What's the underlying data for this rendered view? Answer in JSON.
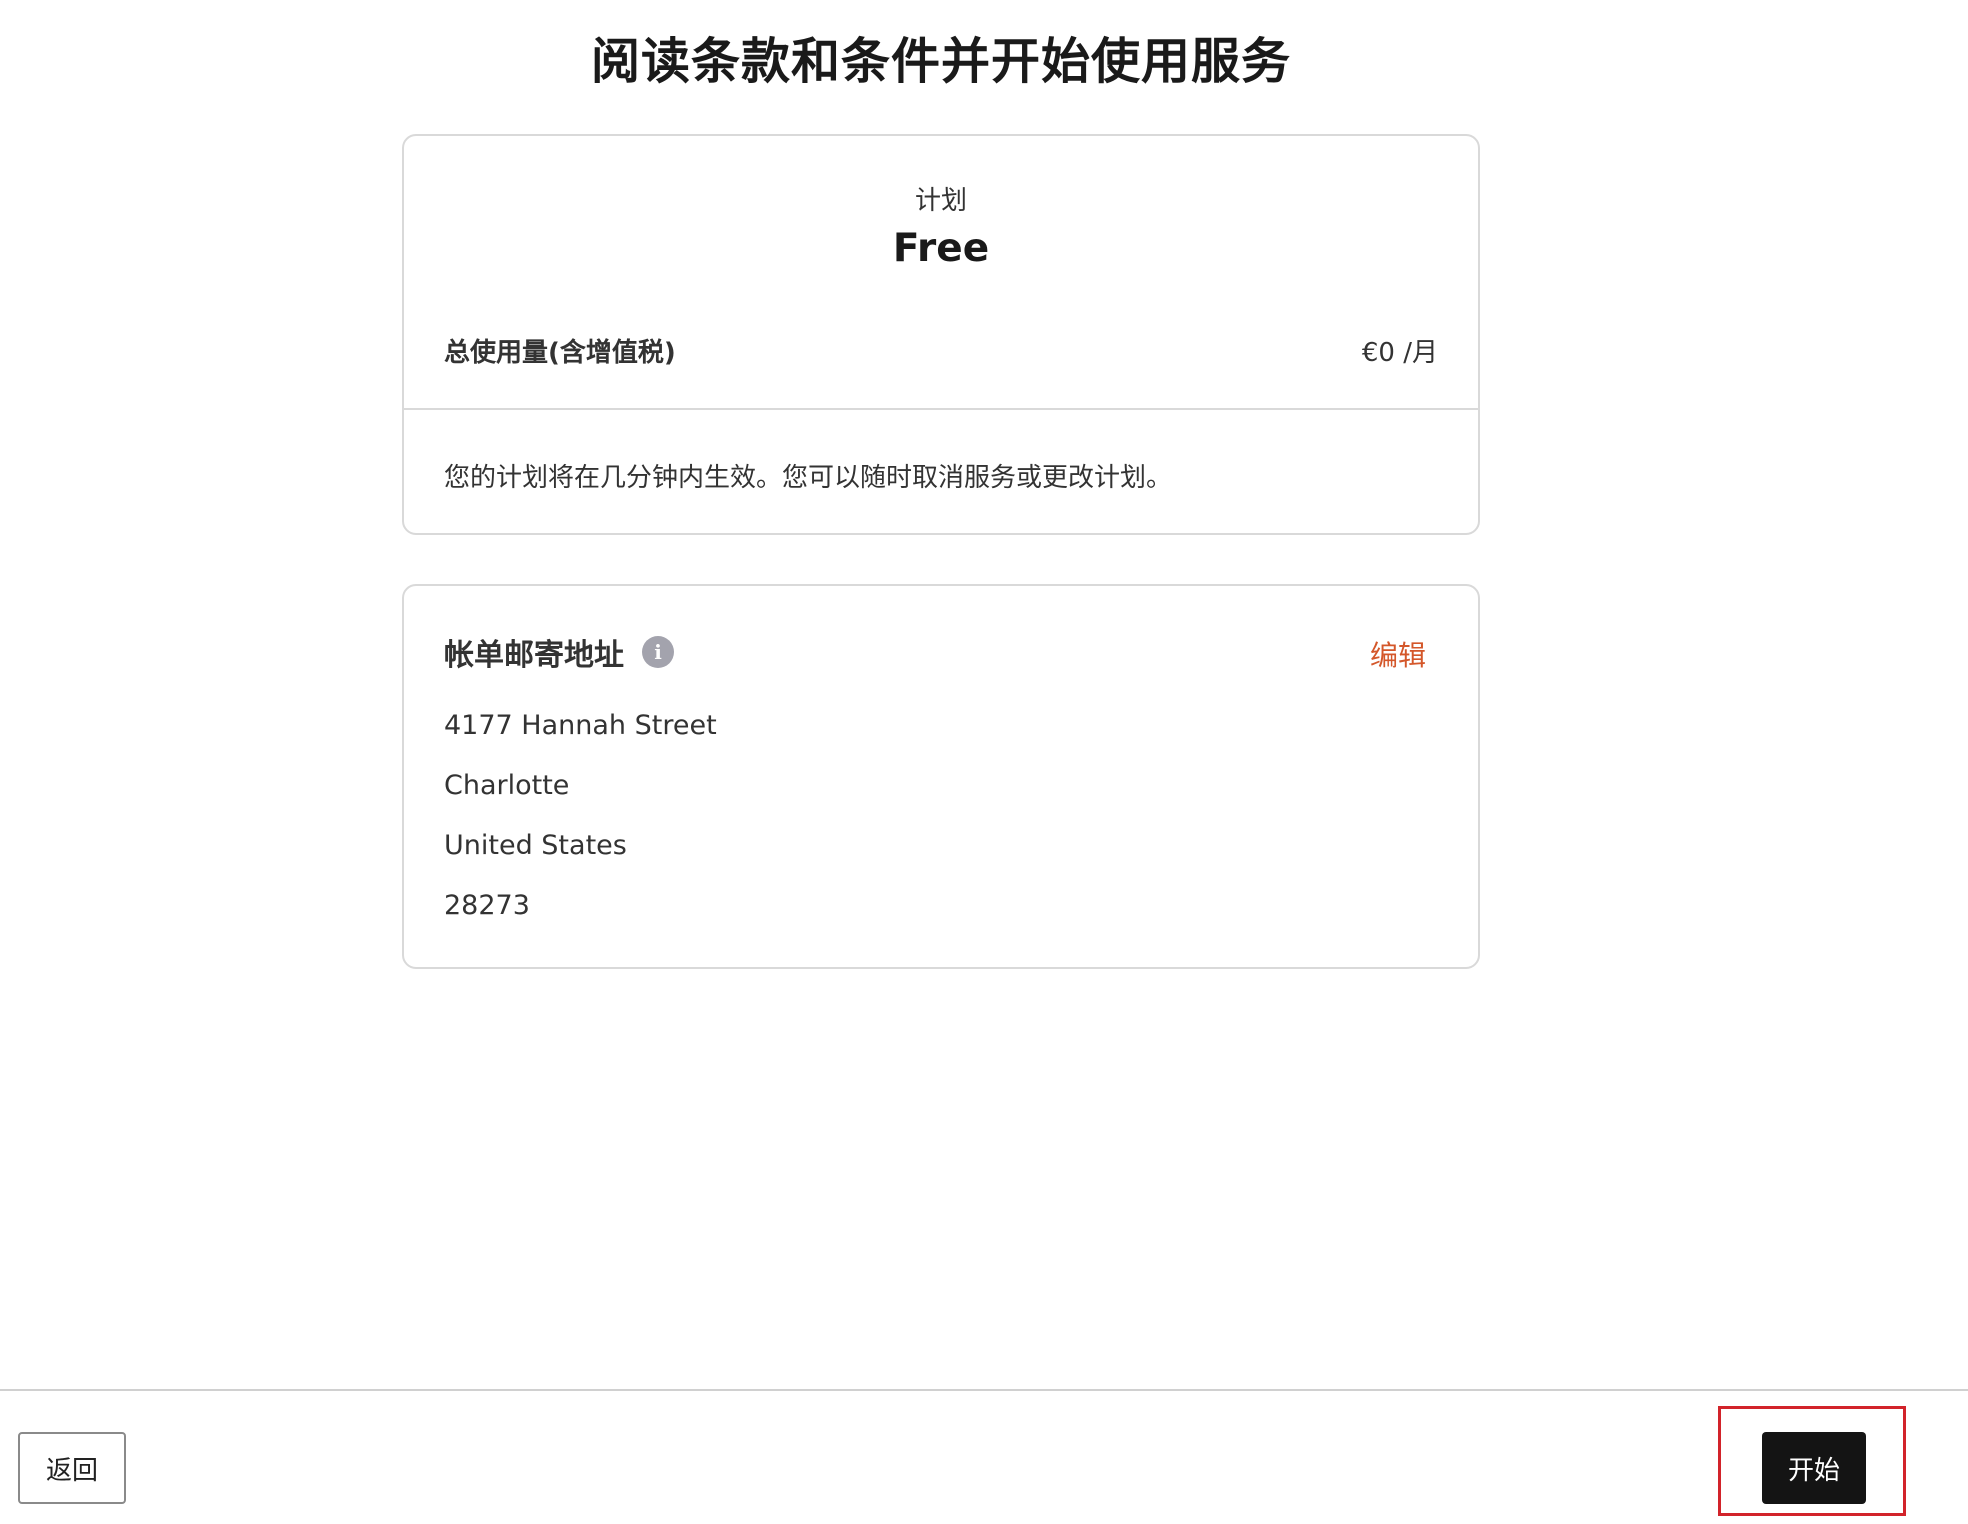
{
  "page": {
    "title": "阅读条款和条件并开始使用服务"
  },
  "plan": {
    "label": "计划",
    "name": "Free",
    "usage_label": "总使用量(含增值税)",
    "usage_price": "€0 /月",
    "note": "您的计划将在几分钟内生效。您可以随时取消服务或更改计划。"
  },
  "billing_address": {
    "title": "帐单邮寄地址",
    "info_icon": "info-icon",
    "info_glyph": "i",
    "edit_label": "编辑",
    "lines": [
      "4177 Hannah Street",
      "Charlotte",
      "United States",
      "28273"
    ]
  },
  "footer": {
    "back_label": "返回",
    "start_label": "开始"
  },
  "colors": {
    "accent_link": "#d4572a",
    "primary_button": "#141414",
    "highlight_box": "#d2232a",
    "border": "#d9d9d9"
  }
}
